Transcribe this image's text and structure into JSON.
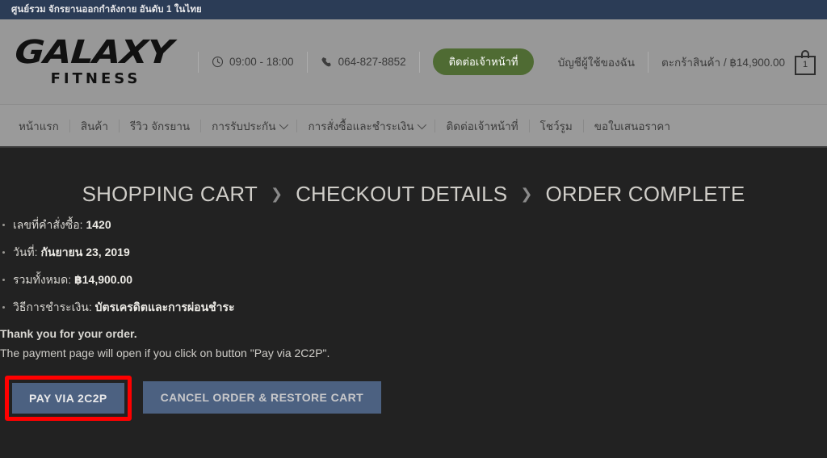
{
  "topbar": {
    "message": "ศูนย์รวม จักรยานออกกำลังกาย อันดับ 1 ในไทย"
  },
  "header": {
    "logo": {
      "wordmark": "GALAXY",
      "subtitle": "FITNESS"
    },
    "hours": {
      "icon": "clock-icon",
      "text": "09:00 - 18:00"
    },
    "phone": {
      "icon": "phone-icon",
      "text": "064-827-8852"
    },
    "contact_button": "ติดต่อเจ้าหน้าที่",
    "account_link": "บัญชีผู้ใช้ของฉัน",
    "cart_link": "ตะกร้าสินค้า / ฿14,900.00",
    "cart_count": "1",
    "accent_green": "#4f6b33"
  },
  "nav": {
    "items": [
      {
        "label": "หน้าแรก",
        "has_caret": false
      },
      {
        "label": "สินค้า",
        "has_caret": false
      },
      {
        "label": "รีวิว จักรยาน",
        "has_caret": false
      },
      {
        "label": "การรับประกัน",
        "has_caret": true
      },
      {
        "label": "การสั่งซื้อและชำระเงิน",
        "has_caret": true
      },
      {
        "label": "ติดต่อเจ้าหน้าที่",
        "has_caret": false
      },
      {
        "label": "โชว์รูม",
        "has_caret": false
      },
      {
        "label": "ขอใบเสนอราคา",
        "has_caret": false
      }
    ]
  },
  "steps": {
    "separator": "❯",
    "items": [
      "SHOPPING CART",
      "CHECKOUT DETAILS",
      "ORDER COMPLETE"
    ]
  },
  "order": {
    "items": [
      {
        "label": "เลขที่คำสั่งซื้อ:",
        "value": "1420"
      },
      {
        "label": "วันที่:",
        "value": "กันยายน 23, 2019"
      },
      {
        "label": "รวมทั้งหมด:",
        "value": "฿14,900.00"
      },
      {
        "label": "วิธีการชำระเงิน:",
        "value": "บัตรเครดิตและการผ่อนชำระ"
      }
    ],
    "thanks": "Thank you for your order.",
    "subtext": "The payment page will open if you click on button \"Pay via 2C2P\"."
  },
  "actions": {
    "pay_button": "PAY VIA 2C2P",
    "cancel_button": "CANCEL ORDER & RESTORE CART",
    "highlight_color": "#ff0000",
    "button_color": "#4c6181"
  }
}
